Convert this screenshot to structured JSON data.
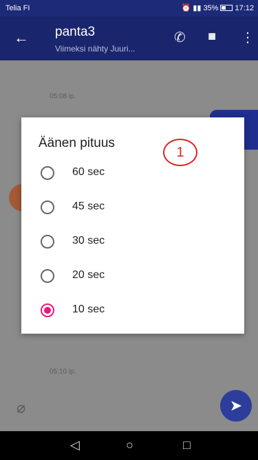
{
  "status": {
    "carrier": "Telia FI",
    "battery": "35%",
    "clock": "17:12"
  },
  "appbar": {
    "title": "panta3",
    "subtitle": "Viimeksi nähty Juuri..."
  },
  "chat": {
    "time1": "05:08 ip.",
    "time2": "05:10 ip."
  },
  "dialog": {
    "title": "Äänen pituus",
    "annotation": "1",
    "options": [
      {
        "label": "60 sec",
        "selected": false
      },
      {
        "label": "45 sec",
        "selected": false
      },
      {
        "label": "30 sec",
        "selected": false
      },
      {
        "label": "20 sec",
        "selected": false
      },
      {
        "label": "10 sec",
        "selected": true
      }
    ]
  },
  "colors": {
    "appbar": "#19256c",
    "accent": "#e9197a",
    "send": "#2c3d9c",
    "annotation": "#e02020"
  },
  "icons": [
    "back-arrow-icon",
    "phone-icon",
    "video-icon",
    "more-icon",
    "attach-icon",
    "send-icon",
    "nav-back-icon",
    "nav-home-icon",
    "nav-recent-icon"
  ]
}
